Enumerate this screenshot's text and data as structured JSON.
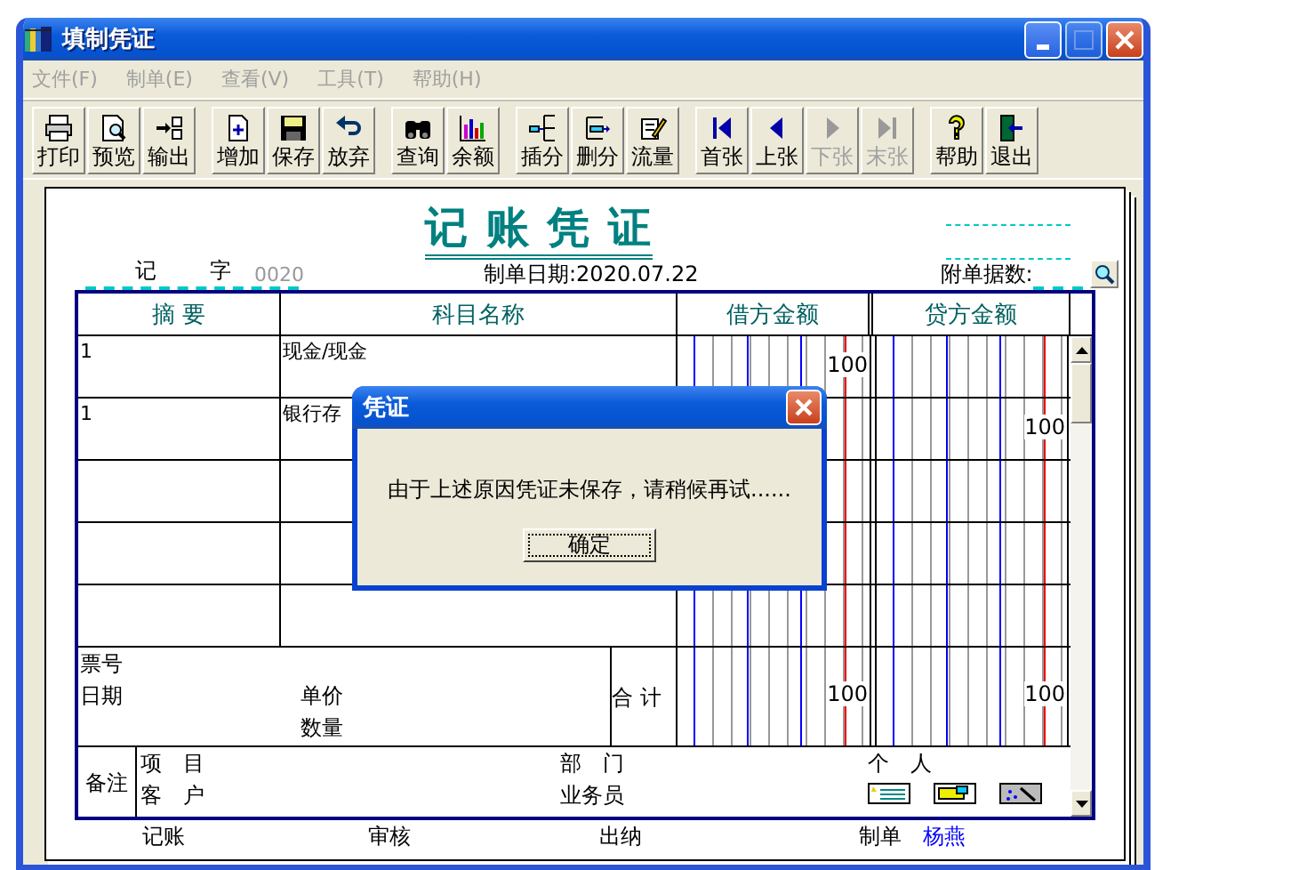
{
  "window": {
    "title": "填制凭证"
  },
  "menu": [
    {
      "label": "文件(F)",
      "disabled": true
    },
    {
      "label": "制单(E)",
      "disabled": true
    },
    {
      "label": "查看(V)",
      "disabled": true
    },
    {
      "label": "工具(T)",
      "disabled": true
    },
    {
      "label": "帮助(H)",
      "disabled": true
    }
  ],
  "toolbar": [
    [
      {
        "kind": "print",
        "label": "打印",
        "disabled": false
      },
      {
        "kind": "preview",
        "label": "预览",
        "disabled": false
      },
      {
        "kind": "export",
        "label": "输出",
        "disabled": false
      }
    ],
    [
      {
        "kind": "add",
        "label": "增加",
        "disabled": false
      },
      {
        "kind": "save",
        "label": "保存",
        "disabled": false
      },
      {
        "kind": "undo",
        "label": "放弃",
        "disabled": false
      }
    ],
    [
      {
        "kind": "binoculars",
        "label": "查询",
        "disabled": false
      },
      {
        "kind": "chart",
        "label": "余额",
        "disabled": false
      }
    ],
    [
      {
        "kind": "insert",
        "label": "插分",
        "disabled": false
      },
      {
        "kind": "delete",
        "label": "删分",
        "disabled": false
      },
      {
        "kind": "pencil",
        "label": "流量",
        "disabled": false
      }
    ],
    [
      {
        "kind": "first",
        "label": "首张",
        "disabled": false
      },
      {
        "kind": "prev",
        "label": "上张",
        "disabled": false
      },
      {
        "kind": "next",
        "label": "下张",
        "disabled": true
      },
      {
        "kind": "last",
        "label": "末张",
        "disabled": true
      }
    ],
    [
      {
        "kind": "help",
        "label": "帮助",
        "disabled": false
      },
      {
        "kind": "exit",
        "label": "退出",
        "disabled": false
      }
    ]
  ],
  "voucher": {
    "title": "记 账 凭 证",
    "type": "记",
    "word": "字",
    "number": "0020",
    "date_label": "制单日期:",
    "date": "2020.07.22",
    "attachments_label": "附单据数:",
    "columns": [
      "摘 要",
      "科目名称",
      "借方金额",
      "贷方金额"
    ],
    "rows": [
      {
        "summary": "1",
        "account": "现金/现金",
        "debit": "100"
      },
      {
        "summary": "1",
        "account": "银行存",
        "credit": "100"
      }
    ],
    "totals": {
      "ticket_label": "票号",
      "date_label": "日期",
      "unit_price_label": "单价",
      "quantity_label": "数量",
      "total_label": "合 计",
      "debit": "100",
      "credit": "100"
    },
    "remarks": {
      "label": "备注",
      "project_label": "项　目",
      "customer_label": "客　户",
      "department_label": "部　门",
      "salesperson_label": "业务员",
      "person_label": "个　人"
    },
    "signatures": [
      {
        "label": "记账"
      },
      {
        "label": "审核"
      },
      {
        "label": "出纳"
      },
      {
        "label": "制单",
        "name": "杨燕"
      }
    ]
  },
  "dialog": {
    "title": "凭证",
    "message": "由于上述原因凭证未保存，请稍候再试......",
    "button": "确定"
  }
}
